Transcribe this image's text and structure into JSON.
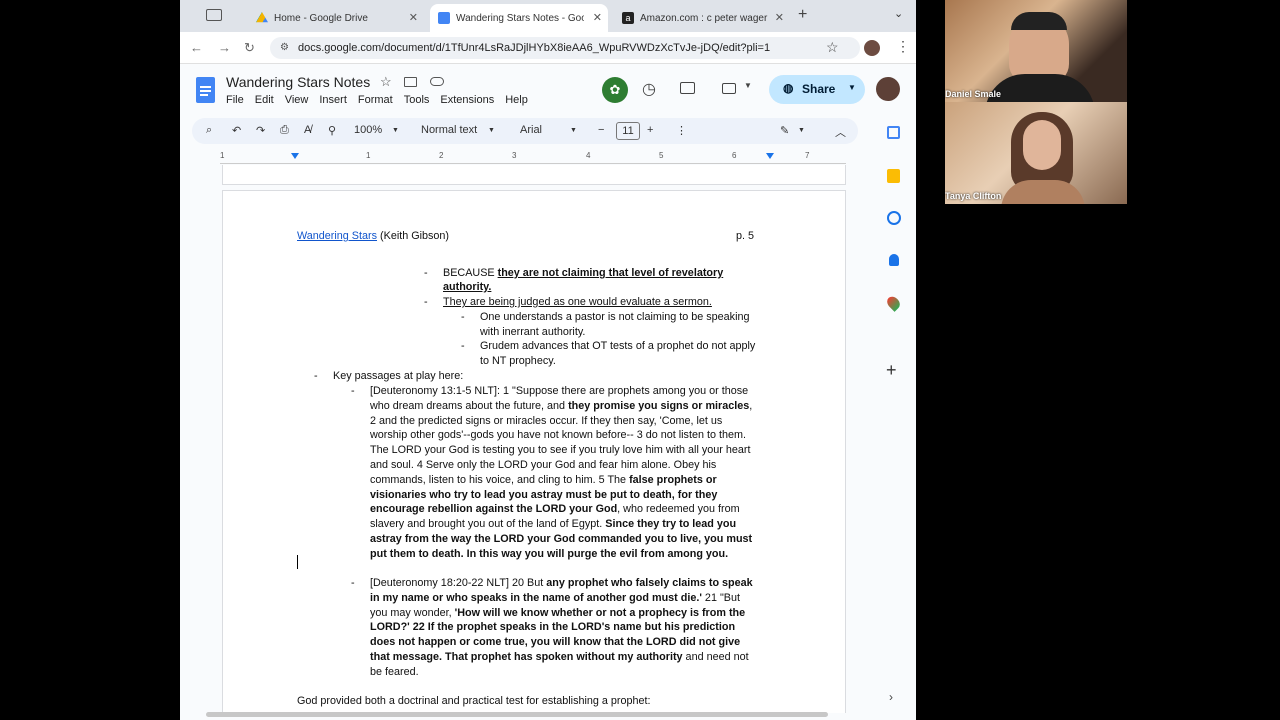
{
  "tabs": [
    {
      "label": "Home - Google Drive",
      "icon": "google-drive-icon",
      "active": false
    },
    {
      "label": "Wandering Stars Notes - Goo",
      "icon": "google-docs-icon",
      "active": true
    },
    {
      "label": "Amazon.com : c peter wager",
      "icon": "amazon-icon",
      "active": false
    }
  ],
  "url": "docs.google.com/document/d/1TfUnr4LsRaJDjlHYbX8ieAA6_WpuRVWDzXcTvJe-jDQ/edit?pli=1",
  "doc": {
    "title": "Wandering Stars Notes",
    "menu": [
      "File",
      "Edit",
      "View",
      "Insert",
      "Format",
      "Tools",
      "Extensions",
      "Help"
    ],
    "share_label": "Share"
  },
  "toolbar": {
    "zoom": "100%",
    "style": "Normal text",
    "font": "Arial",
    "font_size": "11"
  },
  "ruler_marks": [
    "1",
    "1",
    "2",
    "3",
    "4",
    "5",
    "6",
    "7"
  ],
  "content": {
    "header_link": "Wandering Stars",
    "header_author": "(Keith Gibson)",
    "page_num": "p. 5",
    "l1_a": "BECAUSE ",
    "l1_b": "they are not claiming that level of revelatory",
    "l2": "authority.",
    "l3": "They are being judged as one would evaluate a sermon.",
    "l4": "One understands a pastor is not claiming to be speaking",
    "l5": "with inerrant authority.",
    "l6": "Grudem advances that OT tests of a prophet do not apply",
    "l7": "to NT prophecy.",
    "l8": "Key passages at play here:",
    "p1": [
      [
        {
          "t": "[Deuteronomy 13:1-5 NLT]: 1 \"Suppose there are prophets among you or those",
          "b": false
        }
      ],
      [
        {
          "t": "who dream dreams about the future, and ",
          "b": false
        },
        {
          "t": "they promise you signs or miracles",
          "b": true
        },
        {
          "t": ",",
          "b": false
        }
      ],
      [
        {
          "t": "2 and the predicted signs or miracles occur. If they then say, 'Come, let us",
          "b": false
        }
      ],
      [
        {
          "t": "worship other gods'--gods you have not known before-- 3 do not listen to them.",
          "b": false
        }
      ],
      [
        {
          "t": "The LORD your God is testing you to see if you truly love him with all your heart",
          "b": false
        }
      ],
      [
        {
          "t": "and soul. 4 Serve only the LORD your God and fear him alone. Obey his",
          "b": false
        }
      ],
      [
        {
          "t": "commands, listen to his voice, and cling to him. 5 The ",
          "b": false
        },
        {
          "t": "false prophets or",
          "b": true
        }
      ],
      [
        {
          "t": "visionaries who try to lead you astray must be put to death, for they",
          "b": true
        }
      ],
      [
        {
          "t": "encourage rebellion against the LORD your God",
          "b": true
        },
        {
          "t": ", who redeemed you from",
          "b": false
        }
      ],
      [
        {
          "t": "slavery and brought you out of the land of Egypt. ",
          "b": false
        },
        {
          "t": "Since they try to lead you",
          "b": true
        }
      ],
      [
        {
          "t": "astray from the way the LORD your God commanded you to live, you must",
          "b": true
        }
      ],
      [
        {
          "t": "put them to death. In this way you will purge the evil from among you.",
          "b": true
        }
      ]
    ],
    "p2": [
      [
        {
          "t": "[Deuteronomy 18:20-22 NLT] 20 But ",
          "b": false
        },
        {
          "t": "any prophet who falsely claims to speak",
          "b": true
        }
      ],
      [
        {
          "t": "in my name or who speaks in the name of another god must die.'",
          "b": true
        },
        {
          "t": " 21 \"But",
          "b": false
        }
      ],
      [
        {
          "t": "you may wonder, ",
          "b": false
        },
        {
          "t": "'How will we know whether or not a prophecy is from the",
          "b": true
        }
      ],
      [
        {
          "t": "LORD?' 22 If the prophet speaks in the LORD's name but his prediction",
          "b": true
        }
      ],
      [
        {
          "t": "does not happen or come true, you will know that the LORD did not give",
          "b": true
        }
      ],
      [
        {
          "t": "that message. That prophet has spoken without my authority",
          "b": true
        },
        {
          "t": " and need not",
          "b": false
        }
      ],
      [
        {
          "t": "be feared.",
          "b": false
        }
      ]
    ],
    "closing": "God provided both a doctrinal and practical test for establishing a prophet:"
  },
  "participants": [
    {
      "name": "Daniel Smale"
    },
    {
      "name": "Tanya Clifton"
    }
  ],
  "colors": {
    "accent": "#0b57d0",
    "share_bg": "#c2e7ff",
    "link": "#1155cc"
  }
}
